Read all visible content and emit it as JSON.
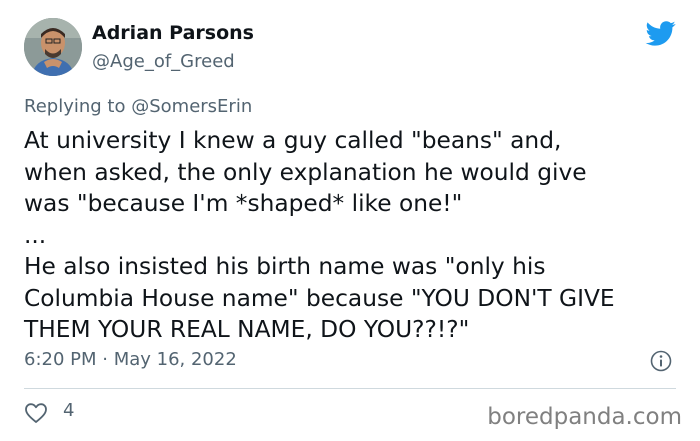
{
  "author": {
    "name": "Adrian Parsons",
    "handle": "@Age_of_Greed"
  },
  "reply": {
    "prefix": "Replying to",
    "mention": "@SomersErin"
  },
  "tweet": {
    "lines": [
      "At university I knew a guy called \"beans\" and,",
      "when asked, the only explanation he would give",
      "was \"because I'm *shaped* like one!\"",
      "...",
      "He also insisted his birth name was \"only his",
      "Columbia House name\" because \"YOU DON'T GIVE",
      "THEM YOUR REAL NAME, DO YOU??!?\""
    ]
  },
  "meta": {
    "timestamp": "6:20 PM · May 16, 2022"
  },
  "stats": {
    "likes": "4"
  },
  "watermark": "boredpanda.com",
  "icons": {
    "brand": "twitter-bird-icon",
    "info": "info-icon",
    "like": "heart-icon"
  },
  "colors": {
    "twitter_blue": "#1d9bf0",
    "secondary_text": "#536471",
    "primary_text": "#0f1419"
  }
}
